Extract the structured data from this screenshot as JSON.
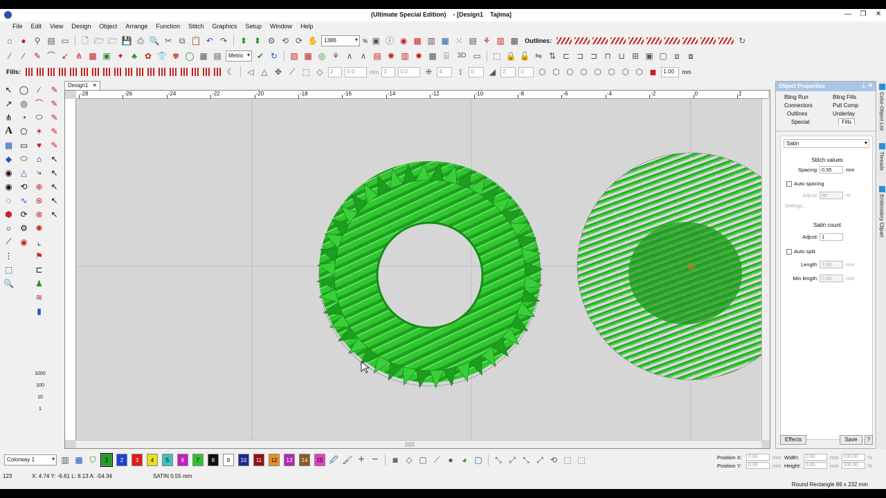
{
  "window": {
    "title_parts": [
      "(Ultimate Special Edition)",
      "- [Design1",
      "Tajima]"
    ],
    "controls": [
      "—",
      "❐",
      "✕"
    ]
  },
  "menu": [
    "File",
    "Edit",
    "View",
    "Design",
    "Object",
    "Arrange",
    "Function",
    "Stitch",
    "Graphics",
    "Setup",
    "Window",
    "Help"
  ],
  "toolbar1": {
    "zoom_value": "1386",
    "zoom_unit": "%",
    "outlines_label": "Outlines:"
  },
  "toolbar2": {
    "units_value": "Metric",
    "tool_3d": "3D"
  },
  "toolbar3": {
    "fills_label": "Fills:",
    "field1": "2",
    "field2": "0.0",
    "field3": "mm",
    "field4": "2",
    "field5": "0.0",
    "field6": "4",
    "field7": "0",
    "field8": "2",
    "field9": "0",
    "scale_value": "1.00",
    "scale_unit": "mm"
  },
  "side_numbers": [
    "1000",
    "100",
    "10",
    "1"
  ],
  "document_tab": {
    "label": "Design1",
    "close": "✕"
  },
  "ruler": {
    "top_labels": [
      "-28",
      "-26",
      "-24",
      "-22",
      "-20",
      "-18",
      "-16",
      "-14",
      "-12",
      "-10",
      "-8",
      "-6",
      "-4",
      "-2",
      "0",
      "2"
    ]
  },
  "object_properties": {
    "title": "Object Properties",
    "tabs": [
      "Bling Run",
      "Bling Fills",
      "Connectors",
      "Pull Comp",
      "Outlines",
      "Underlay",
      "Special",
      "Fills"
    ],
    "active_tab": "Fills",
    "fill_type": "Satin",
    "stitch_values_label": "Stitch values",
    "spacing_label": "Spacing:",
    "spacing_value": "0.55",
    "spacing_unit": "mm",
    "auto_spacing_label": "Auto spacing",
    "adjust_label": "Adjust:",
    "adjust_value": "90",
    "adjust_unit": "%",
    "settings_label": "Settings...",
    "satin_count_label": "Satin count",
    "satin_adjust_label": "Adjust:",
    "satin_adjust_value": "1",
    "auto_split_label": "Auto split",
    "length_label": "Length:",
    "length_value": "7.00",
    "length_unit": "mm",
    "min_length_label": "Min length:",
    "min_length_value": "0.40",
    "min_length_unit": "mm",
    "effects_label": "Effects",
    "save_label": "Save",
    "help_label": "?"
  },
  "side_tabs": [
    "Color-Object List",
    "Threads",
    "Embroidery Clipart"
  ],
  "colorway": {
    "value": "Colorway 1"
  },
  "swatches": [
    {
      "n": "1",
      "color": "#1fa01f"
    },
    {
      "n": "2",
      "color": "#2040d0"
    },
    {
      "n": "3",
      "color": "#e01818"
    },
    {
      "n": "4",
      "color": "#e8e020"
    },
    {
      "n": "5",
      "color": "#40c0c0"
    },
    {
      "n": "6",
      "color": "#c020c0"
    },
    {
      "n": "7",
      "color": "#30c030"
    },
    {
      "n": "8",
      "color": "#101010"
    },
    {
      "n": "9",
      "color": "#ffffff"
    },
    {
      "n": "10",
      "color": "#1a2a90"
    },
    {
      "n": "11",
      "color": "#901010"
    },
    {
      "n": "12",
      "color": "#e89020"
    },
    {
      "n": "13",
      "color": "#b02ab0"
    },
    {
      "n": "14",
      "color": "#8a5a20"
    },
    {
      "n": "15",
      "color": "#e040c0"
    }
  ],
  "position": {
    "x_label": "Position X:",
    "y_label": "Position Y:",
    "x_value": "0.00",
    "y_value": "0.00",
    "unit": "mm",
    "width_label": "Width:",
    "height_label": "Height:",
    "width_value": "0.00",
    "height_value": "0.00",
    "width_pct": "100.00",
    "height_pct": "100.00",
    "pct_unit": "%"
  },
  "status": {
    "count": "123",
    "coords": "X: 4.74 Y: -6.61 L: 8.13 A: -54.34",
    "stitch": "SATIN 0.55 mm",
    "object": "Round Rectangle 86 x 232 mm"
  },
  "colors": {
    "embroidery_green": "#2fc82f",
    "embroidery_dark": "#168c16",
    "panel_title": "#aac6e6",
    "canvas_bg": "#d6d6d6"
  }
}
